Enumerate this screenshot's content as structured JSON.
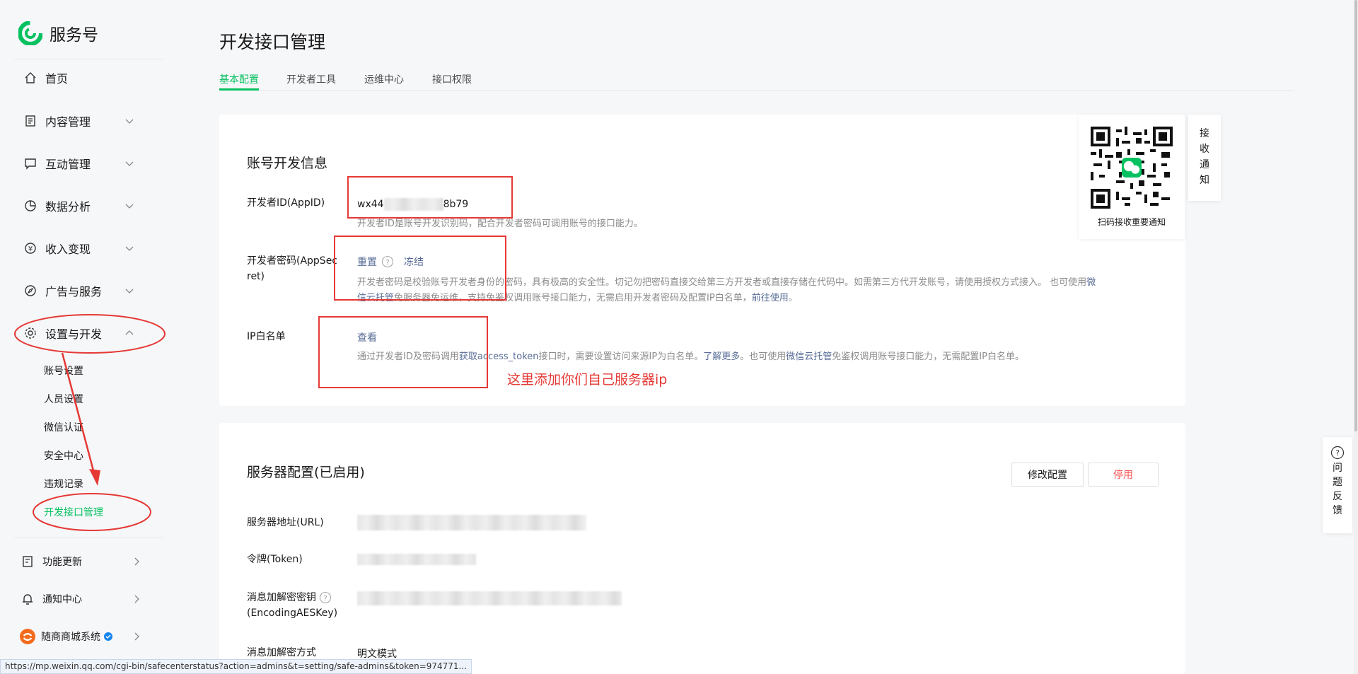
{
  "brand": {
    "name": "服务号"
  },
  "sidebar": {
    "nav": [
      {
        "label": "首页",
        "icon": "home-icon"
      },
      {
        "label": "内容管理",
        "icon": "document-icon"
      },
      {
        "label": "互动管理",
        "icon": "chat-icon"
      },
      {
        "label": "数据分析",
        "icon": "pie-chart-icon"
      },
      {
        "label": "收入变现",
        "icon": "yen-icon"
      },
      {
        "label": "广告与服务",
        "icon": "compass-icon"
      },
      {
        "label": "设置与开发",
        "icon": "gear-icon"
      }
    ],
    "sub": [
      "账号设置",
      "人员设置",
      "微信认证",
      "安全中心",
      "违规记录",
      "开发接口管理"
    ],
    "bottom": [
      {
        "label": "功能更新",
        "icon": "update-icon"
      },
      {
        "label": "通知中心",
        "icon": "bell-icon"
      },
      {
        "label": "随商商城系统",
        "icon": "avatar-icon"
      }
    ]
  },
  "page": {
    "title": "开发接口管理"
  },
  "tabs": [
    "基本配置",
    "开发者工具",
    "运维中心",
    "接口权限"
  ],
  "account_info": {
    "title": "账号开发信息",
    "appid_label": "开发者ID(AppID)",
    "appid_prefix": "wx44",
    "appid_suffix": "8b79",
    "appid_desc": "开发者ID是账号开发识别码，配合开发者密码可调用账号的接口能力。",
    "secret_label_1": "开发者密码(AppSec",
    "secret_label_2": "ret)",
    "reset": "重置",
    "freeze": "冻结",
    "secret_desc_1": "开发者密码是校验账号开发者身份的密码，具有极高的安全性。切记勿把密码直接交给第三方开发者或直接存储在代码中。如需第三方代开发账号，请使用授权方式接入。 也可使用",
    "secret_desc_link1": "微",
    "secret_desc_link1b": "信云托管",
    "secret_desc_2": "免服务器免运维，支持免鉴权调用账号接口能力，无需启用开发者密码及配置IP白名单，",
    "secret_desc_link2": "前往使用",
    "secret_desc_end": "。",
    "ip_label": "IP白名单",
    "ip_view": "查看",
    "ip_desc_1": "通过开发者ID及密码调用",
    "ip_desc_link1": "获取access_token",
    "ip_desc_2": "接口时，需要设置访问来源IP为白名单。",
    "ip_desc_link2": "了解更多",
    "ip_desc_3": "。也可使用",
    "ip_desc_link3": "微信云托管",
    "ip_desc_4": "免鉴权调用账号接口能力，无需配置IP白名单。",
    "annotation": "这里添加你们自己服务器ip"
  },
  "qr": {
    "caption": "扫码接收重要通知"
  },
  "receive_tab": "接收通知",
  "feedback_tab": "问题反馈",
  "server": {
    "title": "服务器配置(已启用)",
    "modify": "修改配置",
    "disable": "停用",
    "url_label": "服务器地址(URL)",
    "token_label": "令牌(Token)",
    "aes_label_1": "消息加解密密钥",
    "aes_label_2": "(EncodingAESKey)",
    "mode_label": "消息加解密方式",
    "mode_value": "明文模式"
  },
  "status_url": "https://mp.weixin.qq.com/cgi-bin/safecenterstatus?action=admins&t=setting/safe-admins&token=974771...",
  "colors": {
    "accent": "#07c160",
    "annotation": "#e53935",
    "link": "#576b95",
    "danger": "#fa5151"
  }
}
